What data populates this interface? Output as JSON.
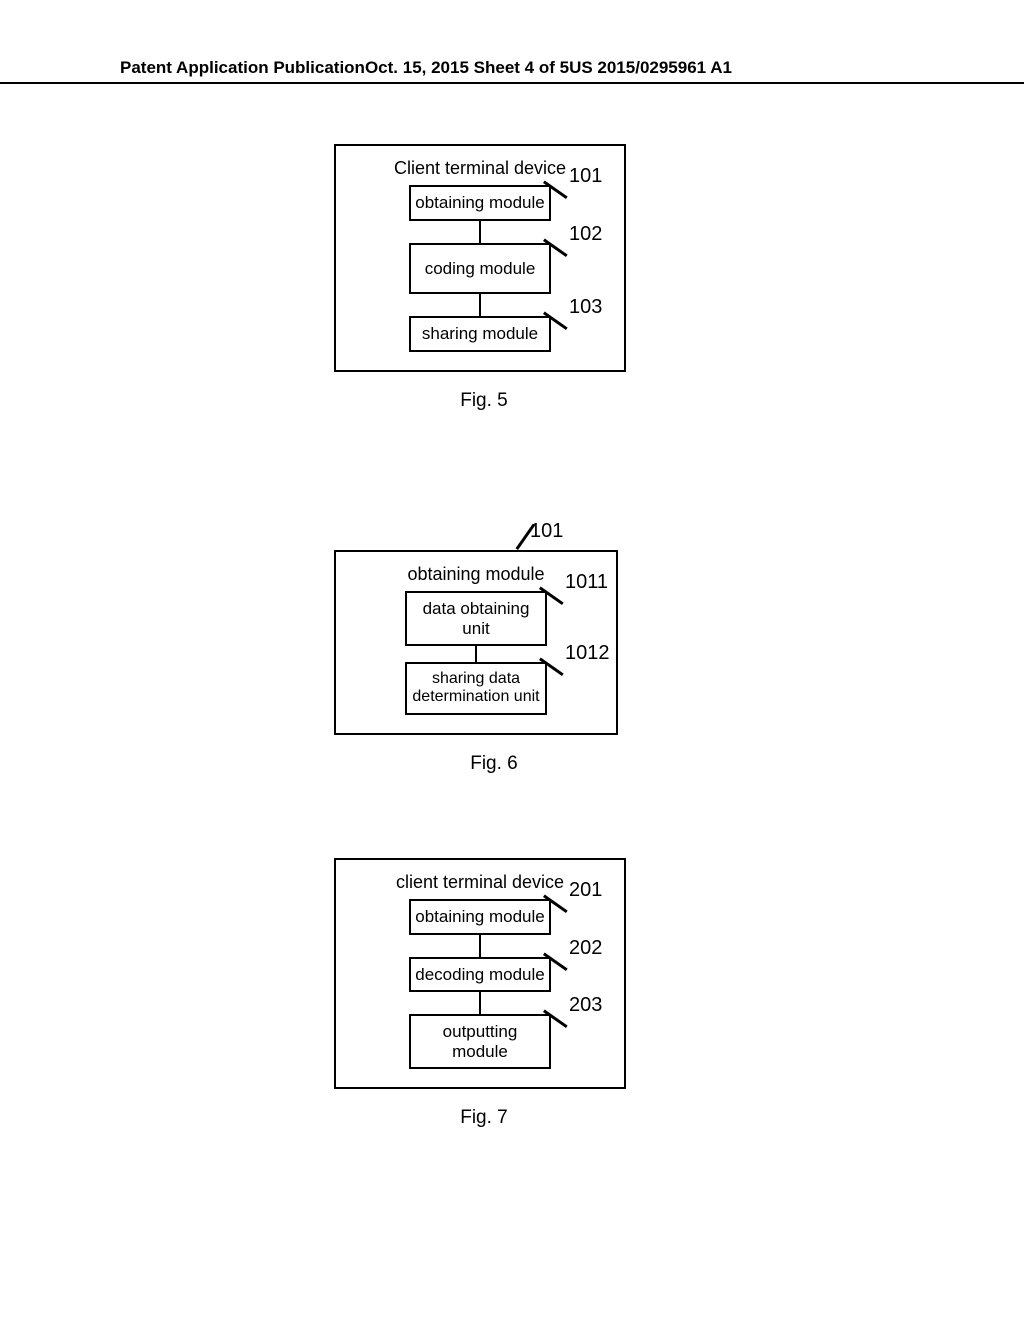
{
  "header": {
    "left": "Patent Application Publication",
    "center": "Oct. 15, 2015  Sheet 4 of 5",
    "right": "US 2015/0295961 A1"
  },
  "fig5": {
    "caption": "Fig. 5",
    "container_title": "Client terminal device",
    "m1": {
      "label": "obtaining module",
      "ref": "101"
    },
    "m2": {
      "label": "coding module",
      "ref": "102"
    },
    "m3": {
      "label": "sharing module",
      "ref": "103"
    }
  },
  "fig6": {
    "caption": "Fig. 6",
    "container_title": "obtaining module",
    "container_ref": "101",
    "u1": {
      "label": "data obtaining unit",
      "ref": "1011"
    },
    "u2": {
      "label": "sharing data determination unit",
      "ref": "1012"
    }
  },
  "fig7": {
    "caption": "Fig. 7",
    "container_title": "client terminal device",
    "m1": {
      "label": "obtaining module",
      "ref": "201"
    },
    "m2": {
      "label": "decoding module",
      "ref": "202"
    },
    "m3": {
      "label": "outputting module",
      "ref": "203"
    }
  }
}
